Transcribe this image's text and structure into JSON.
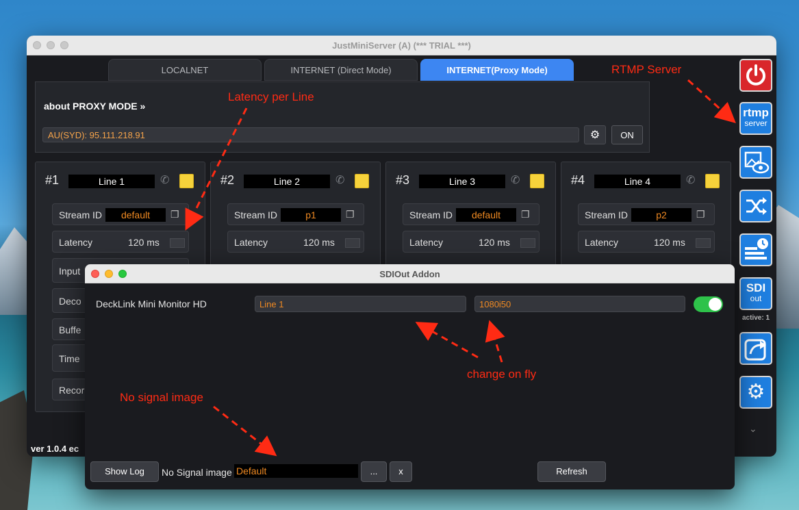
{
  "main_window": {
    "title": "JustMiniServer (A) (*** TRIAL ***)",
    "tabs": [
      {
        "label": "LOCALNET"
      },
      {
        "label": "INTERNET (Direct Mode)"
      },
      {
        "label": "INTERNET(Proxy Mode)"
      }
    ],
    "proxy": {
      "header": "about PROXY MODE »",
      "address": "AU(SYD): 95.111.218.91",
      "on_label": "ON"
    },
    "lines": [
      {
        "num": "#1",
        "name": "Line 1",
        "stream_label": "Stream ID",
        "stream_id": "default",
        "latency_label": "Latency",
        "latency": "120 ms"
      },
      {
        "num": "#2",
        "name": "Line 2",
        "stream_label": "Stream ID",
        "stream_id": "p1",
        "latency_label": "Latency",
        "latency": "120 ms"
      },
      {
        "num": "#3",
        "name": "Line 3",
        "stream_label": "Stream ID",
        "stream_id": "default",
        "latency_label": "Latency",
        "latency": "120 ms"
      },
      {
        "num": "#4",
        "name": "Line 4",
        "stream_label": "Stream ID",
        "stream_id": "p2",
        "latency_label": "Latency",
        "latency": "120 ms"
      }
    ],
    "partial_rows": [
      "Input",
      "Deco",
      "Buffe",
      "Time",
      "Recor"
    ],
    "version": "ver 1.0.4  ec",
    "sidebar": {
      "rtmp_top": "rtmp",
      "rtmp_bottom": "server",
      "sdi_top": "SDI",
      "sdi_bottom": "out",
      "active": "active: 1"
    }
  },
  "dialog": {
    "title": "SDIOut Addon",
    "device": "DeckLink Mini Monitor HD",
    "line": "Line 1",
    "format": "1080i50",
    "show_log": "Show Log",
    "no_signal_label": "No Signal image",
    "no_signal_value": "Default",
    "browse": "...",
    "clear": "x",
    "refresh": "Refresh"
  },
  "annotations": {
    "latency": "Latency per Line",
    "rtmp": "RTMP Server",
    "change": "change on fly",
    "nosignal": "No signal image"
  },
  "colors": {
    "accent": "#3d86f2",
    "value": "#f08a22",
    "annotation": "#ff2b14",
    "toggle_on": "#2ec24a"
  }
}
